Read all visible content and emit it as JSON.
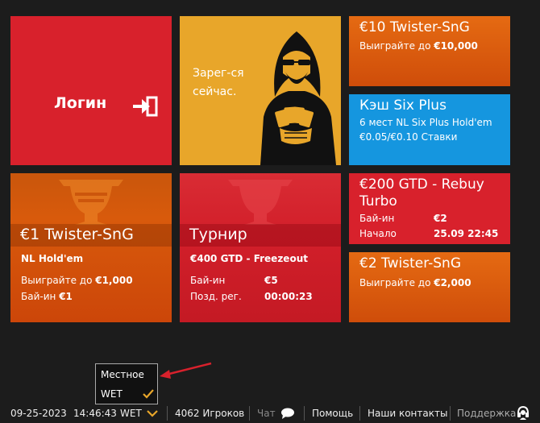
{
  "tiles": {
    "login": {
      "label": "Логин"
    },
    "register": {
      "text": "Зарег-ся сейчас."
    },
    "twister10": {
      "title": "€10 Twister-SnG",
      "win_prefix": "Выиграйте до",
      "win_amount": "€10,000"
    },
    "cash": {
      "title": "Кэш Six Plus",
      "line1": "6 мест NL Six Plus Hold'em",
      "line2": "€0.05/€0.10 Ставки"
    },
    "gtd200": {
      "title": "€200 GTD - Rebuy Turbo",
      "buyin_label": "Бай-ин",
      "buyin_value": "€2",
      "start_label": "Начало",
      "start_value": "25.09 22:45"
    },
    "twister2": {
      "title": "€2 Twister-SnG",
      "win_prefix": "Выиграйте до",
      "win_amount": "€2,000"
    },
    "twister1": {
      "title": "€1 Twister-SnG",
      "subtitle": "NL Hold'em",
      "win_prefix": "Выиграйте до",
      "win_amount": "€1,000",
      "buyin_label": "Бай-ин",
      "buyin_value": "€1"
    },
    "tournament": {
      "title": "Турнир",
      "subtitle": "€400 GTD - Freezeout",
      "buyin_label": "Бай-ин",
      "buyin_value": "€5",
      "late_label": "Позд. рег.",
      "late_value": "00:00:23"
    }
  },
  "timezone_popup": {
    "options": [
      "Местное",
      "WET"
    ],
    "selected": "WET"
  },
  "footer": {
    "date": "09-25-2023",
    "time": "14:46:43",
    "timezone": "WET",
    "players": "4062 Игроков",
    "chat": "Чат",
    "help": "Помощь",
    "contacts": "Наши контакты",
    "support": "Поддержка"
  },
  "colors": {
    "red": "#d8212c",
    "orange": "#e56a12",
    "blue": "#1596df",
    "yellow": "#e8a62a",
    "check": "#e8a62a"
  }
}
